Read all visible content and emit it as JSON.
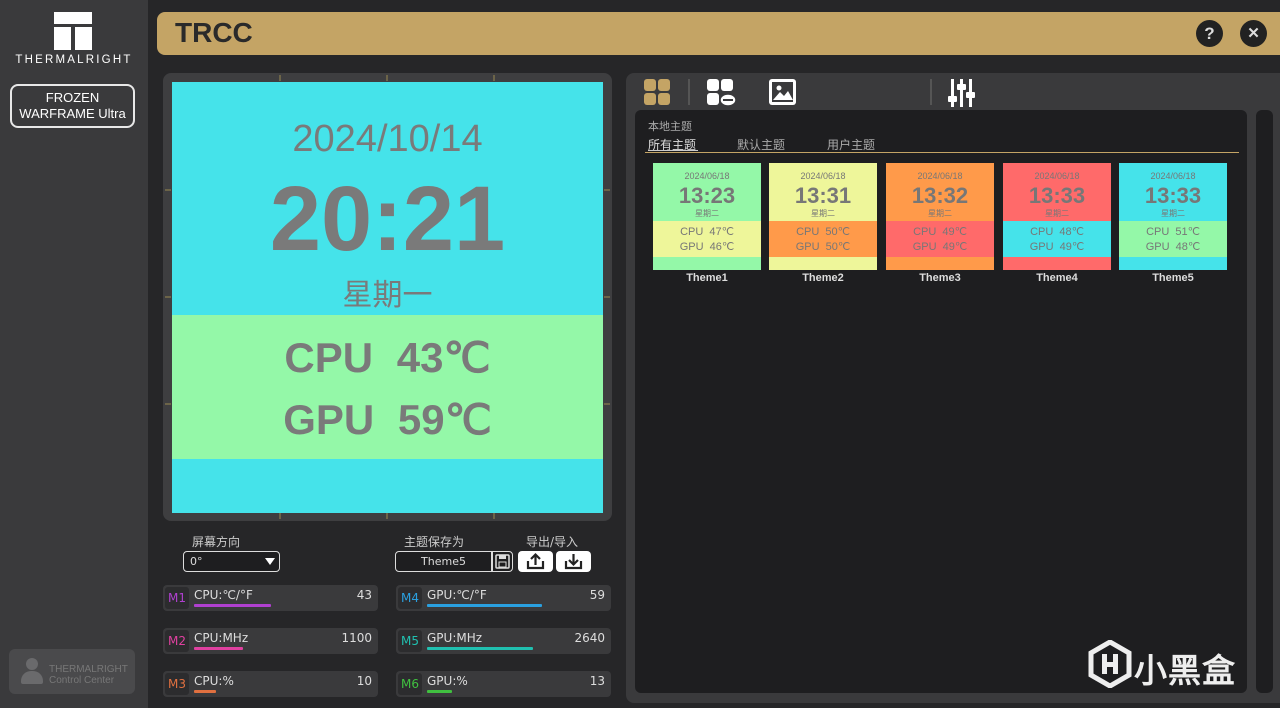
{
  "sidebar": {
    "brand": "THERMALRIGHT",
    "device_line1": "FROZEN",
    "device_line2": "WARFRAME Ultra",
    "cc_line1": "THERMALRIGHT",
    "cc_line2": "Control Center"
  },
  "titlebar": {
    "title": "TRCC",
    "help_icon": "?",
    "close_icon": "✕"
  },
  "preview": {
    "date": "2024/10/14",
    "time": "20:21",
    "weekday": "星期一",
    "cpu_line": "CPU 43℃",
    "gpu_line": "GPU 59℃",
    "bg_color": "#45e3ea",
    "band_color": "#94f8a8"
  },
  "controls": {
    "orientation_label": "屏幕方向",
    "orientation_value": "0°",
    "save_label": "主题保存为",
    "save_value": "Theme5",
    "io_label": "导出/导入",
    "save_icon": "floppy-disk-icon",
    "export_icon": "upload-icon",
    "import_icon": "download-icon"
  },
  "metrics": [
    {
      "tag": "M1",
      "name": "CPU:℃/°F",
      "value": "43",
      "color": "#b040d0",
      "fill": 0.43
    },
    {
      "tag": "M2",
      "name": "CPU:MHz",
      "value": "1100",
      "color": "#e040a0",
      "fill": 0.27
    },
    {
      "tag": "M3",
      "name": "CPU:%",
      "value": "10",
      "color": "#e07040",
      "fill": 0.12
    },
    {
      "tag": "M4",
      "name": "GPU:℃/°F",
      "value": "59",
      "color": "#2aa0e0",
      "fill": 0.64
    },
    {
      "tag": "M5",
      "name": "GPU:MHz",
      "value": "2640",
      "color": "#20c0b0",
      "fill": 0.59
    },
    {
      "tag": "M6",
      "name": "GPU:%",
      "value": "13",
      "color": "#40c040",
      "fill": 0.14
    }
  ],
  "toolbar": {
    "icons": [
      "grid-icon",
      "theme-cloud-icon",
      "image-icon",
      "sliders-icon"
    ]
  },
  "gallery": {
    "section_title": "本地主题",
    "tabs": [
      "所有主题",
      "默认主题",
      "用户主题"
    ],
    "active_tab": "所有主题",
    "themes": [
      {
        "name": "Theme1",
        "date": "2024/06/18",
        "time": "13:23",
        "week": "星期二",
        "cpu": "CPU 47℃",
        "gpu": "GPU 46℃",
        "bg": "#94f8a8",
        "band": "#eef69a"
      },
      {
        "name": "Theme2",
        "date": "2024/06/18",
        "time": "13:31",
        "week": "星期二",
        "cpu": "CPU 50℃",
        "gpu": "GPU 50℃",
        "bg": "#eef69a",
        "band": "#ff9a4a"
      },
      {
        "name": "Theme3",
        "date": "2024/06/18",
        "time": "13:32",
        "week": "星期二",
        "cpu": "CPU 49℃",
        "gpu": "GPU 49℃",
        "bg": "#ff9a4a",
        "band": "#ff6a6a"
      },
      {
        "name": "Theme4",
        "date": "2024/06/18",
        "time": "13:33",
        "week": "星期二",
        "cpu": "CPU 48℃",
        "gpu": "GPU 49℃",
        "bg": "#ff6a6a",
        "band": "#45e3ea"
      },
      {
        "name": "Theme5",
        "date": "2024/06/18",
        "time": "13:33",
        "week": "星期二",
        "cpu": "CPU 51℃",
        "gpu": "GPU 48℃",
        "bg": "#45e3ea",
        "band": "#94f8a8"
      }
    ]
  },
  "watermark": {
    "text": "小黑盒"
  },
  "colors": {
    "accent": "#c4a465"
  }
}
